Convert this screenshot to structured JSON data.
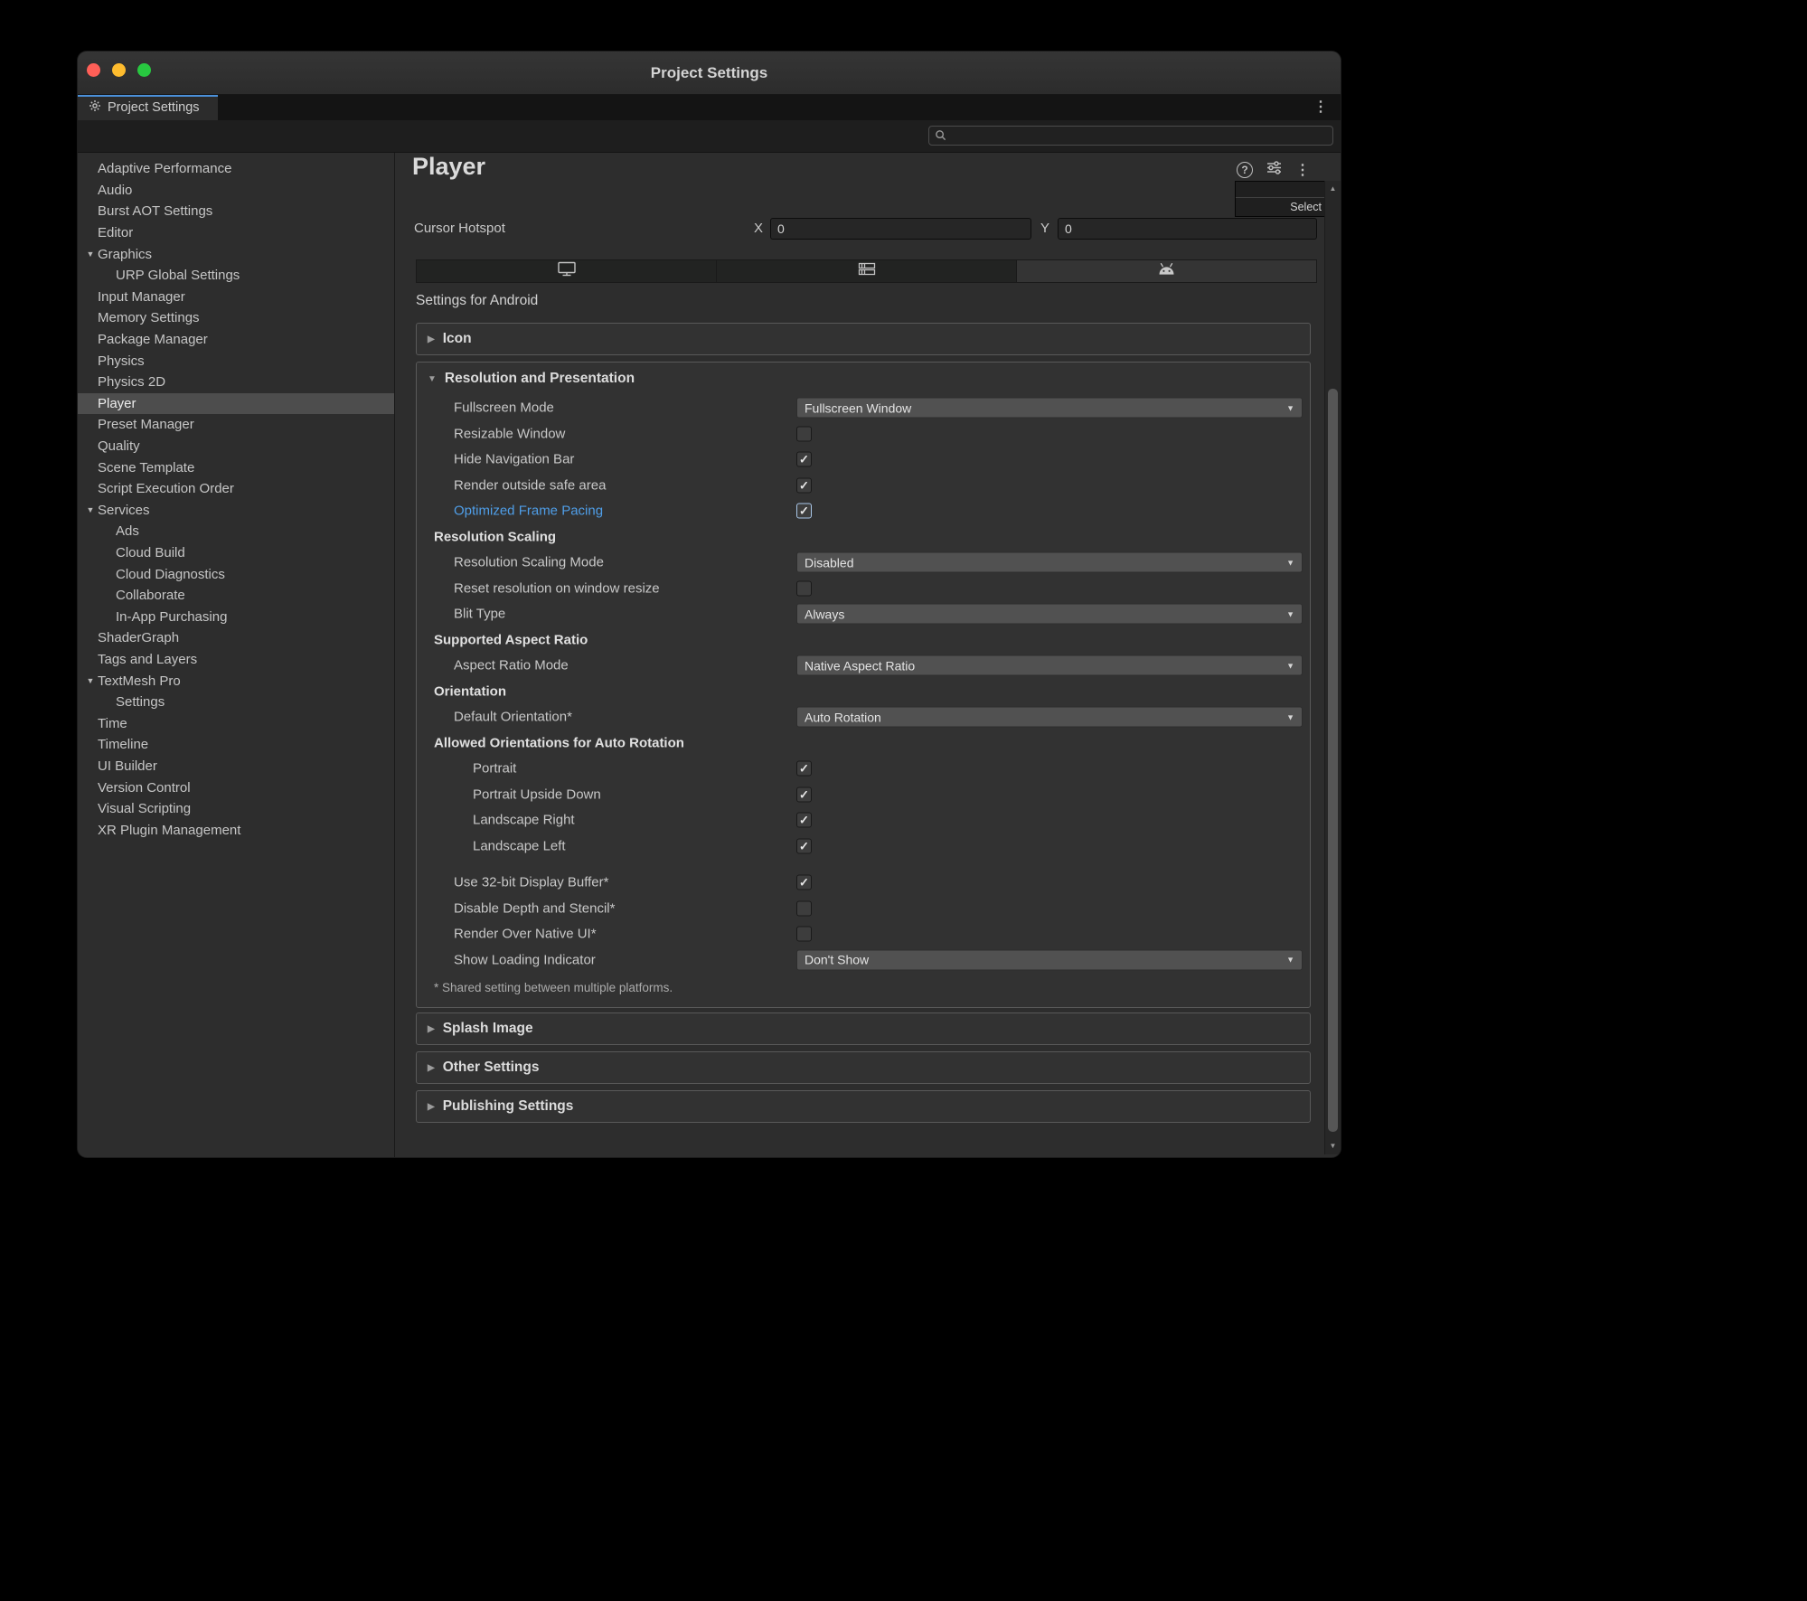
{
  "colors": {
    "close": "#ff5f57",
    "minimize": "#febc2e",
    "zoom": "#28c840",
    "accent": "#4a90d9",
    "modified_blue": "#4f9ee8",
    "selection": "#4d4d4d"
  },
  "window": {
    "title": "Project Settings",
    "tab_label": "Project Settings",
    "menu_icon": "⋮"
  },
  "toolbar": {
    "search_value": ""
  },
  "sidebar": {
    "items": [
      {
        "label": "Adaptive Performance"
      },
      {
        "label": "Audio"
      },
      {
        "label": "Burst AOT Settings"
      },
      {
        "label": "Editor"
      },
      {
        "label": "Graphics",
        "fold": "open"
      },
      {
        "label": "URP Global Settings",
        "indent": 1
      },
      {
        "label": "Input Manager"
      },
      {
        "label": "Memory Settings"
      },
      {
        "label": "Package Manager"
      },
      {
        "label": "Physics"
      },
      {
        "label": "Physics 2D"
      },
      {
        "label": "Player",
        "selected": true
      },
      {
        "label": "Preset Manager"
      },
      {
        "label": "Quality"
      },
      {
        "label": "Scene Template"
      },
      {
        "label": "Script Execution Order"
      },
      {
        "label": "Services",
        "fold": "open"
      },
      {
        "label": "Ads",
        "indent": 1
      },
      {
        "label": "Cloud Build",
        "indent": 1
      },
      {
        "label": "Cloud Diagnostics",
        "indent": 1
      },
      {
        "label": "Collaborate",
        "indent": 1
      },
      {
        "label": "In-App Purchasing",
        "indent": 1
      },
      {
        "label": "ShaderGraph"
      },
      {
        "label": "Tags and Layers"
      },
      {
        "label": "TextMesh Pro",
        "fold": "open"
      },
      {
        "label": "Settings",
        "indent": 1
      },
      {
        "label": "Time"
      },
      {
        "label": "Timeline"
      },
      {
        "label": "UI Builder"
      },
      {
        "label": "Version Control"
      },
      {
        "label": "Visual Scripting"
      },
      {
        "label": "XR Plugin Management"
      }
    ]
  },
  "main": {
    "title": "Player",
    "select_button": "Select",
    "cursor_hotspot": {
      "label": "Cursor Hotspot",
      "x_label": "X",
      "x_value": "0",
      "y_label": "Y",
      "y_value": "0"
    },
    "platform_tabs": [
      {
        "icon": "desktop-icon",
        "active": false
      },
      {
        "icon": "server-icon",
        "active": false
      },
      {
        "icon": "android-icon",
        "active": true
      }
    ],
    "settings_for": "Settings for Android",
    "sections": {
      "icon": "Icon",
      "splash": "Splash Image",
      "other": "Other Settings",
      "publishing": "Publishing Settings"
    },
    "resolution": {
      "header": "Resolution and Presentation",
      "rows": [
        {
          "type": "dropdown",
          "label": "Fullscreen Mode",
          "value": "Fullscreen Window"
        },
        {
          "type": "checkbox",
          "label": "Resizable Window",
          "checked": false
        },
        {
          "type": "checkbox",
          "label": "Hide Navigation Bar",
          "checked": true
        },
        {
          "type": "checkbox",
          "label": "Render outside safe area",
          "checked": true
        },
        {
          "type": "checkbox",
          "label": "Optimized Frame Pacing",
          "checked": true,
          "blue": true,
          "hl": true
        },
        {
          "type": "subheader",
          "label": "Resolution Scaling"
        },
        {
          "type": "dropdown",
          "label": "Resolution Scaling Mode",
          "value": "Disabled"
        },
        {
          "type": "checkbox",
          "label": "Reset resolution on window resize",
          "checked": false
        },
        {
          "type": "dropdown",
          "label": "Blit Type",
          "value": "Always"
        },
        {
          "type": "subheader",
          "label": "Supported Aspect Ratio"
        },
        {
          "type": "dropdown",
          "label": "Aspect Ratio Mode",
          "value": "Native Aspect Ratio"
        },
        {
          "type": "subheader",
          "label": "Orientation"
        },
        {
          "type": "dropdown",
          "label": "Default Orientation*",
          "value": "Auto Rotation"
        },
        {
          "type": "subheader",
          "label": "Allowed Orientations for Auto Rotation"
        },
        {
          "type": "checkbox",
          "label": "Portrait",
          "checked": true,
          "indent": 2
        },
        {
          "type": "checkbox",
          "label": "Portrait Upside Down",
          "checked": true,
          "indent": 2
        },
        {
          "type": "checkbox",
          "label": "Landscape Right",
          "checked": true,
          "indent": 2
        },
        {
          "type": "checkbox",
          "label": "Landscape Left",
          "checked": true,
          "indent": 2
        },
        {
          "type": "spacer"
        },
        {
          "type": "checkbox",
          "label": "Use 32-bit Display Buffer*",
          "checked": true
        },
        {
          "type": "checkbox",
          "label": "Disable Depth and Stencil*",
          "checked": false
        },
        {
          "type": "checkbox",
          "label": "Render Over Native UI*",
          "checked": false
        },
        {
          "type": "dropdown",
          "label": "Show Loading Indicator",
          "value": "Don't Show"
        }
      ],
      "footnote": "* Shared setting between multiple platforms."
    }
  }
}
